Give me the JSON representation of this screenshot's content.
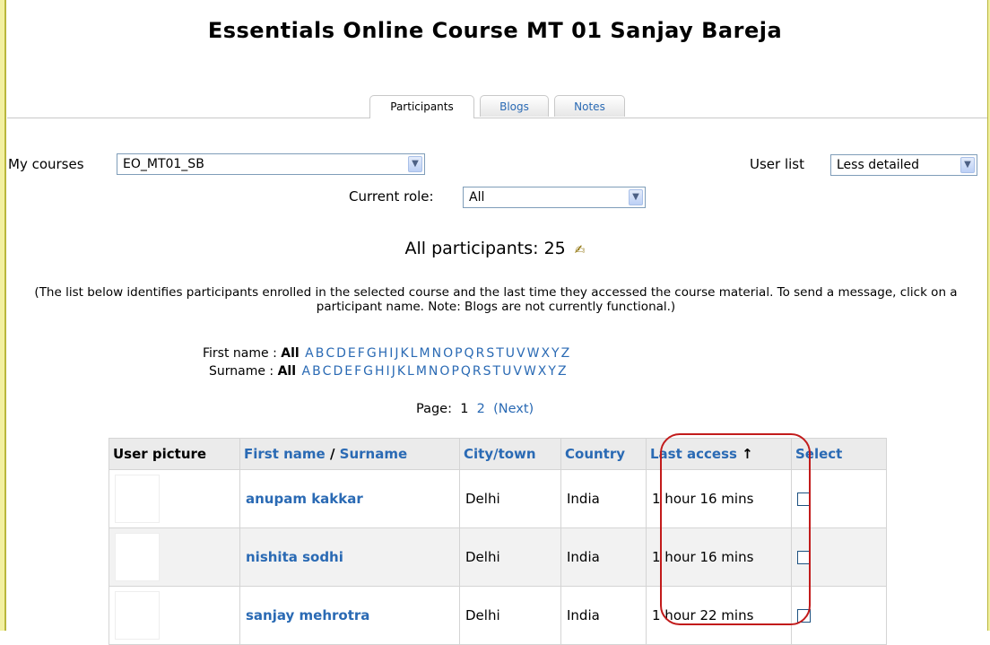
{
  "page": {
    "title": "Essentials Online Course MT 01 Sanjay Bareja"
  },
  "tabs": [
    "Participants",
    "Blogs",
    "Notes"
  ],
  "my_courses": {
    "label": "My courses",
    "value": "EO_MT01_SB"
  },
  "user_list": {
    "label": "User list",
    "value": "Less detailed"
  },
  "current_role": {
    "label": "Current role:",
    "value": "All"
  },
  "participants": {
    "heading": "All participants: 25",
    "edit_icon": "edit-icon"
  },
  "intro": "(The list below identifies participants enrolled in the selected course and the last time they accessed the course material. To send a message, click on a participant name. Note: Blogs are not currently functional.)",
  "initials": {
    "first_label": "First name :",
    "surname_label": "Surname :",
    "all": "All",
    "letters": [
      "A",
      "B",
      "C",
      "D",
      "E",
      "F",
      "G",
      "H",
      "I",
      "J",
      "K",
      "L",
      "M",
      "N",
      "O",
      "P",
      "Q",
      "R",
      "S",
      "T",
      "U",
      "V",
      "W",
      "X",
      "Y",
      "Z"
    ]
  },
  "pager": {
    "label": "Page:",
    "current": "1",
    "next_page": "2",
    "next_label": "(Next)"
  },
  "table": {
    "headers": {
      "user_picture": "User picture",
      "first_name": "First name",
      "separator": "/",
      "surname": "Surname",
      "city": "City/town",
      "country": "Country",
      "last_access": "Last access",
      "sort_arrow": "↑",
      "select": "Select"
    },
    "rows": [
      {
        "name": "anupam kakkar",
        "city": "Delhi",
        "country": "India",
        "last_access": "1 hour 16 mins"
      },
      {
        "name": "nishita sodhi",
        "city": "Delhi",
        "country": "India",
        "last_access": "1 hour 16 mins"
      },
      {
        "name": "sanjay mehrotra",
        "city": "Delhi",
        "country": "India",
        "last_access": "1 hour 22 mins"
      }
    ]
  },
  "colors": {
    "link": "#2a6ab4",
    "highlight": "#c21b1b",
    "frame": "#f2f0a0"
  }
}
